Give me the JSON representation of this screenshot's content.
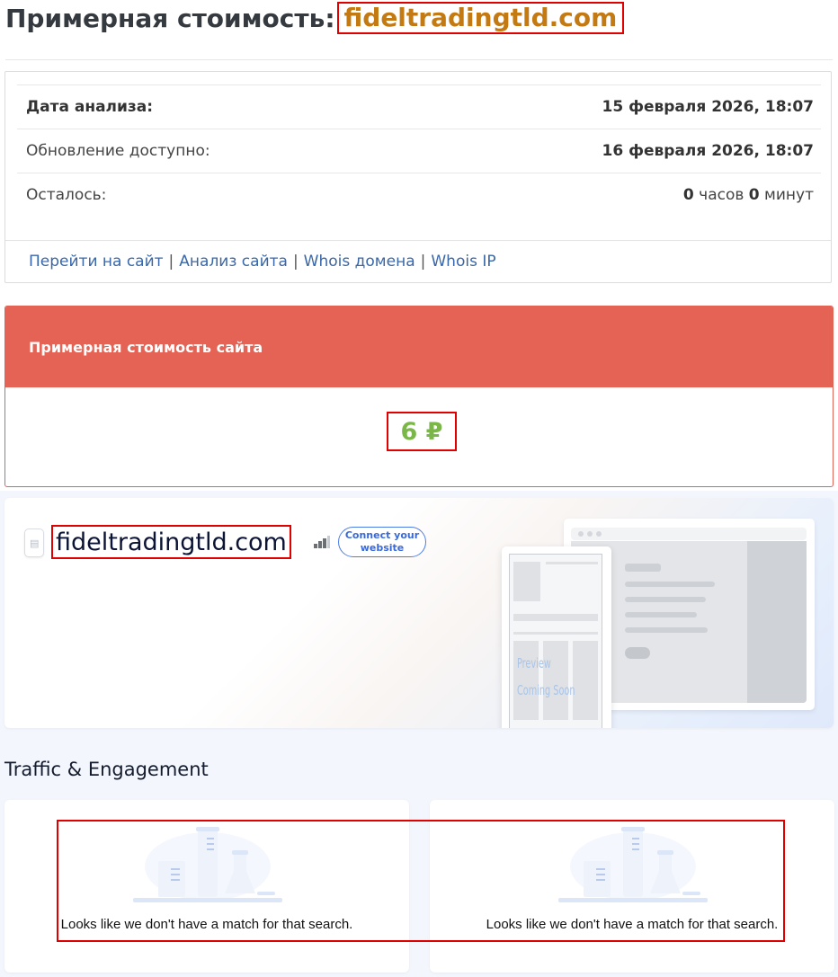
{
  "header": {
    "title_prefix": "Примерная стоимость:",
    "domain": "fideltradingtld.com"
  },
  "info": {
    "rows": [
      {
        "label": "Дата анализа:",
        "value": "15 февраля 2026, 18:07"
      },
      {
        "label": "Обновление доступно:",
        "value": "16 февраля 2026, 18:07"
      },
      {
        "label": "Осталось:",
        "hours": "0",
        "hours_unit": "часов",
        "minutes": "0",
        "minutes_unit": "минут"
      }
    ],
    "links": [
      "Перейти на сайт",
      "Анализ сайта",
      "Whois домена",
      "Whois IP"
    ]
  },
  "cost": {
    "heading": "Примерная стоимость сайта",
    "value": "6 ₽"
  },
  "sw": {
    "domain": "fideltradingtld.com",
    "connect_button": "Connect your website",
    "preview_line1": "Preview",
    "preview_line2": "Coming Soon",
    "traffic_title": "Traffic & Engagement",
    "empty_message_left": "Looks like we don't have a match for that search.",
    "empty_message_right": "Looks like we don't have a match for that search."
  },
  "colors": {
    "domain_highlight": "#c47a12",
    "cost_header_bg": "#e46355",
    "cost_value": "#7ab648",
    "link": "#3a67a8",
    "annotation_box": "#e00000"
  }
}
